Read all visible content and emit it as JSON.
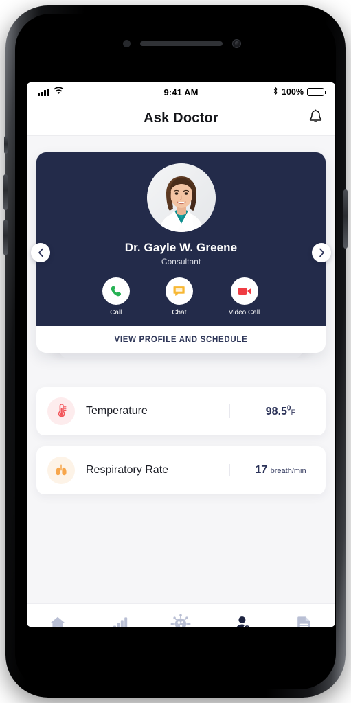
{
  "status_bar": {
    "time": "9:41 AM",
    "battery_percent": "100%",
    "signal_icon": "cellular-signal-icon",
    "wifi_icon": "wifi-icon",
    "bluetooth_icon": "bluetooth-icon",
    "battery_icon": "battery-full-icon"
  },
  "header": {
    "title": "Ask Doctor",
    "bell_icon": "notification-bell-icon"
  },
  "doctor_card": {
    "name": "Dr. Gayle W. Greene",
    "role": "Consultant",
    "avatar_icon": "doctor-avatar-photo",
    "actions": [
      {
        "label": "Call",
        "icon": "phone-icon",
        "color": "#27b254"
      },
      {
        "label": "Chat",
        "icon": "chat-bubble-icon",
        "color": "#f7b733"
      },
      {
        "label": "Video Call",
        "icon": "video-camera-icon",
        "color": "#ef3c43"
      }
    ],
    "view_profile_label": "VIEW PROFILE AND SCHEDULE",
    "prev_arrow_icon": "chevron-left-icon",
    "next_arrow_icon": "chevron-right-icon",
    "card_background": "#232b4a"
  },
  "vitals": [
    {
      "label": "Temperature",
      "icon": "thermometer-icon",
      "icon_color": "#f2555a",
      "icon_bg": "#fdeced",
      "value": "98.5",
      "superscript": "0",
      "unit": "F"
    },
    {
      "label": "Respiratory Rate",
      "icon": "lungs-icon",
      "icon_color": "#f7a64b",
      "icon_bg": "#fdf3e7",
      "value": "17",
      "superscript": "",
      "unit": "breath/min"
    }
  ],
  "bottom_nav": {
    "items": [
      {
        "icon": "home-icon",
        "active": false
      },
      {
        "icon": "bar-chart-icon",
        "active": false
      },
      {
        "icon": "virus-icon",
        "active": false
      },
      {
        "icon": "add-person-icon",
        "active": true
      },
      {
        "icon": "document-icon",
        "active": false
      }
    ],
    "inactive_color": "#b9bfd4",
    "active_color": "#1d2340"
  }
}
